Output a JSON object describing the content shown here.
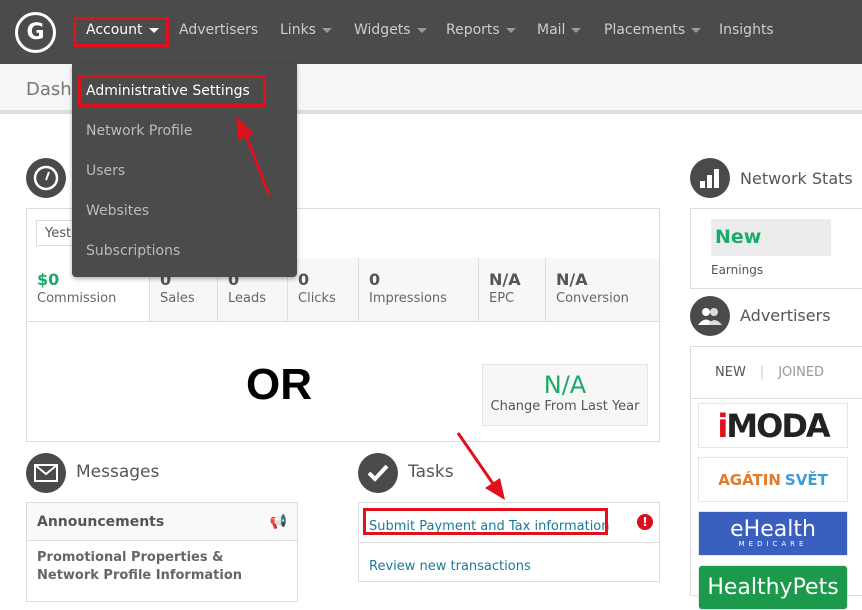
{
  "nav": {
    "items": [
      {
        "label": "Account",
        "dropdown": true
      },
      {
        "label": "Advertisers",
        "dropdown": false
      },
      {
        "label": "Links",
        "dropdown": true
      },
      {
        "label": "Widgets",
        "dropdown": true
      },
      {
        "label": "Reports",
        "dropdown": true
      },
      {
        "label": "Mail",
        "dropdown": true
      },
      {
        "label": "Placements",
        "dropdown": true
      },
      {
        "label": "Insights",
        "dropdown": false
      }
    ]
  },
  "account_menu": {
    "items": [
      "Administrative Settings",
      "Network Profile",
      "Users",
      "Websites",
      "Subscriptions"
    ],
    "highlighted": "Administrative Settings"
  },
  "page_title": "Dashb",
  "date_select": "Yest",
  "stats": [
    {
      "value": "$0",
      "label": "Commission"
    },
    {
      "value": "0",
      "label": "Sales"
    },
    {
      "value": "0",
      "label": "Leads"
    },
    {
      "value": "0",
      "label": "Clicks"
    },
    {
      "value": "0",
      "label": "Impressions"
    },
    {
      "value": "N/A",
      "label": "EPC"
    },
    {
      "value": "N/A",
      "label": "Conversion"
    }
  ],
  "overlay_text": "OR",
  "change": {
    "value": "N/A",
    "label": "Change From Last Year"
  },
  "messages": {
    "title": "Messages",
    "announcements": "Announcements",
    "item": "Promotional Properties & Network Profile Information"
  },
  "tasks": {
    "title": "Tasks",
    "items": [
      "Submit Payment and Tax information",
      "Review new transactions"
    ]
  },
  "network_stats": {
    "title": "Network Stats",
    "value": "New",
    "label": "Earnings"
  },
  "advertisers": {
    "title": "Advertisers",
    "tabs": [
      "NEW",
      "JOINED"
    ],
    "logos": [
      "iMODA",
      "AGÁTIN SVĚT",
      "eHealth",
      "MEDICARE",
      "HealthyPets"
    ]
  },
  "colors": {
    "nav": "#4b4b4b",
    "green": "#1aaa6a",
    "link": "#1a7a9a",
    "annotation": "#e0101c"
  }
}
